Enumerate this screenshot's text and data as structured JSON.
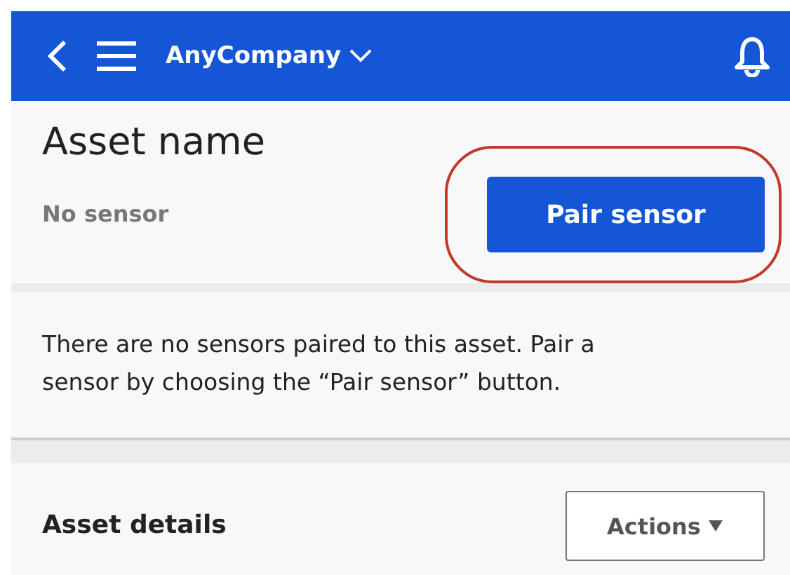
{
  "header": {
    "company": "AnyCompany"
  },
  "asset": {
    "title": "Asset name",
    "status": "No sensor",
    "pair_button": "Pair sensor",
    "highlighted": true
  },
  "message": "There are no sensors paired to this asset. Pair a sensor by choosing the “Pair sensor” button.",
  "details": {
    "title": "Asset details",
    "actions_button": "Actions"
  }
}
